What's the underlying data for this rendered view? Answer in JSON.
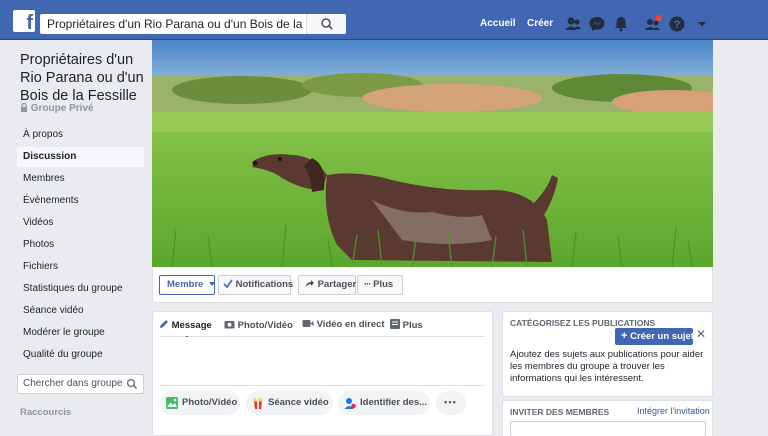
{
  "topbar": {
    "search_value": "Propriétaires d'un Rio Parana ou d'un Bois de la Fessille",
    "home_label": "Accueil",
    "create_label": "Créer"
  },
  "sidebar": {
    "group_name": "Propriétaires d'un Rio Parana ou d'un Bois de la Fessille",
    "privacy": "Groupe Privé",
    "items": [
      {
        "label": "À propos"
      },
      {
        "label": "Discussion"
      },
      {
        "label": "Membres"
      },
      {
        "label": "Évènements"
      },
      {
        "label": "Vidéos"
      },
      {
        "label": "Photos"
      },
      {
        "label": "Fichiers"
      },
      {
        "label": "Statistiques du groupe"
      },
      {
        "label": "Séance vidéo"
      },
      {
        "label": "Modérer le groupe"
      },
      {
        "label": "Qualité du groupe"
      }
    ],
    "search_placeholder": "Chercher dans groupe",
    "shortcuts_heading": "Raccourcis"
  },
  "cover_actions": {
    "member_label": "Membre",
    "notifications_label": "Notifications",
    "share_label": "Partager",
    "more_label": "Plus"
  },
  "composer": {
    "tabs": [
      {
        "label": "Message"
      },
      {
        "label": "Photo/Vidéo"
      },
      {
        "label": "Vidéo en direct"
      },
      {
        "label": "Plus"
      }
    ],
    "actions": [
      {
        "label": "Photo/Vidéo"
      },
      {
        "label": "Séance vidéo"
      },
      {
        "label": "Identifier des..."
      }
    ]
  },
  "topics_card": {
    "heading": "CATÉGORISEZ LES PUBLICATIONS",
    "create_label": "Créer un sujet",
    "body": "Ajoutez des sujets aux publications pour aider les membres du groupe à trouver les informations qui les intéressent."
  },
  "invite_card": {
    "heading": "INVITER DES MEMBRES",
    "embed_link": "Intégrer l'invitation"
  },
  "colors": {
    "brand_blue": "#4267b2",
    "page_bg": "#e9ebee",
    "notification_dot": "#fa3e3e"
  }
}
